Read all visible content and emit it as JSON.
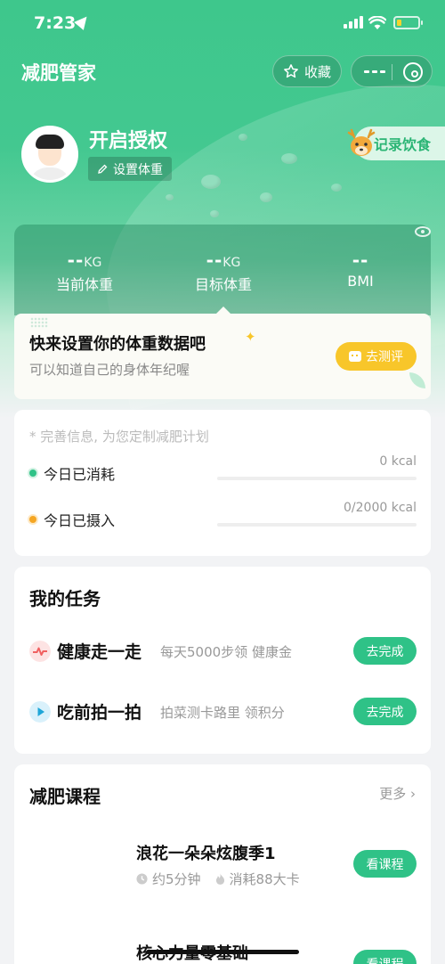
{
  "status_bar": {
    "time": "7:23"
  },
  "header": {
    "title": "减肥管家",
    "favorite_label": "收藏"
  },
  "profile": {
    "name": "开启授权",
    "set_weight_label": "设置体重",
    "diet_record_label": "记录饮食"
  },
  "stats": [
    {
      "value": "--",
      "unit": "KG",
      "label": "当前体重"
    },
    {
      "value": "--",
      "unit": "KG",
      "label": "目标体重"
    },
    {
      "value": "--",
      "unit": "",
      "label": "BMI"
    }
  ],
  "prompt": {
    "title": "快来设置你的体重数据吧",
    "subtitle": "可以知道自己的身体年纪喔",
    "button_label": "去测评"
  },
  "energy": {
    "hint": "完善信息, 为您定制减肥计划",
    "rows": [
      {
        "label": "今日已消耗",
        "value_text": "0 kcal",
        "progress": 0,
        "dot_color": "#2fc287"
      },
      {
        "label": "今日已摄入",
        "value_text": "0/2000 kcal",
        "progress": 0,
        "dot_color": "#f5a623"
      }
    ]
  },
  "tasks": {
    "title": "我的任务",
    "items": [
      {
        "name": "健康走一走",
        "desc": "每天5000步领 健康金",
        "button": "去完成",
        "icon": "pulse-icon"
      },
      {
        "name": "吃前拍一拍",
        "desc": "拍菜测卡路里 领积分",
        "button": "去完成",
        "icon": "play-icon"
      }
    ]
  },
  "courses": {
    "title": "减肥课程",
    "more_label": "更多",
    "items": [
      {
        "title": "浪花一朵朵炫腹季1",
        "duration": "约5分钟",
        "calories": "消耗88大卡",
        "button": "看课程"
      },
      {
        "title": "核心力量零基础",
        "duration": "",
        "calories": "",
        "button": "看课程"
      }
    ]
  },
  "colors": {
    "brand_green": "#2fc287",
    "accent_yellow": "#f8c62a",
    "orange_dot": "#f5a623"
  }
}
